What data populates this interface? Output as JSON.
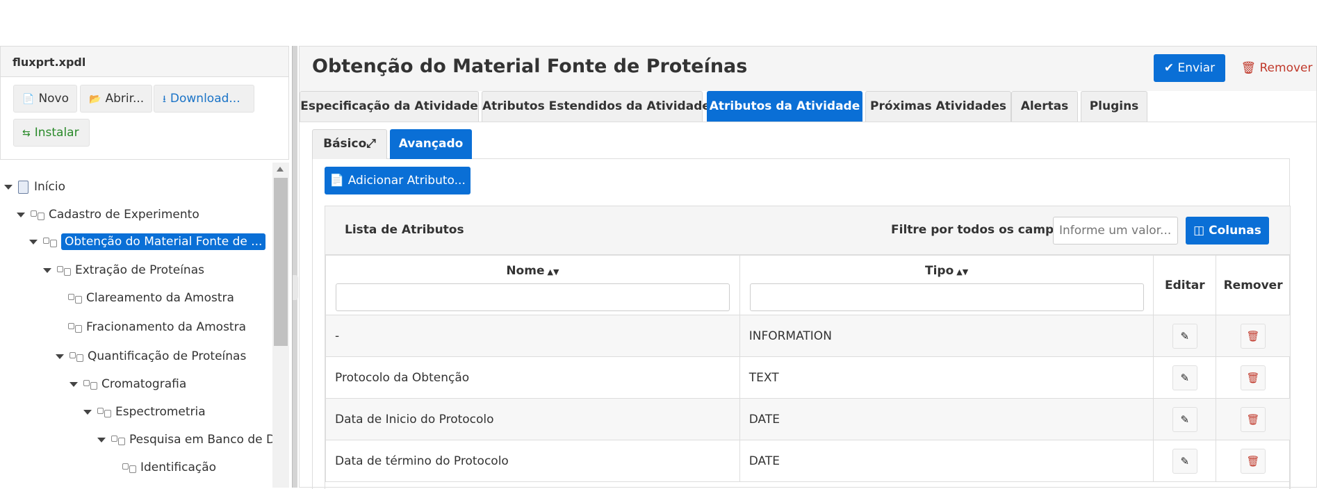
{
  "file": {
    "title": "fluxprt.xpdl",
    "buttons": {
      "novo": "Novo",
      "abrir": "Abrir...",
      "download": "Download...",
      "instalar": "Instalar"
    }
  },
  "tree": {
    "nodes": [
      {
        "label": "Início",
        "expanded": true
      },
      {
        "label": "Cadastro de Experimento",
        "expanded": true
      },
      {
        "label": "Obtenção do Material Fonte de ...",
        "expanded": true,
        "selected": true
      },
      {
        "label": "Extração de Proteínas",
        "expanded": true
      },
      {
        "label": "Clareamento da Amostra"
      },
      {
        "label": "Fracionamento da Amostra"
      },
      {
        "label": "Quantificação de Proteínas",
        "expanded": true
      },
      {
        "label": "Cromatografia",
        "expanded": true
      },
      {
        "label": "Espectrometria",
        "expanded": true
      },
      {
        "label": "Pesquisa em Banco de Dad",
        "expanded": true
      },
      {
        "label": "Identificação"
      }
    ]
  },
  "main": {
    "title": "Obtenção do Material Fonte de Proteínas",
    "enviar": "Enviar",
    "remover": "Remover",
    "tabs": [
      "Especificação da Atividade",
      "Atributos Estendidos da Atividade",
      "Atributos da Atividade",
      "Próximas Atividades",
      "Alertas",
      "Plugins"
    ],
    "active_tab": "Atributos da Atividade",
    "subtabs": [
      "Básico",
      "Avançado"
    ],
    "active_subtab": "Avançado",
    "add_button": "Adicionar Atributo..."
  },
  "list": {
    "title": "Lista de Atributos",
    "filter_label": "Filtre por todos os campos:",
    "filter_placeholder": "Informe um valor...",
    "columns_button": "Colunas",
    "headers": {
      "nome": "Nome",
      "tipo": "Tipo",
      "editar": "Editar",
      "remover": "Remover"
    },
    "rows": [
      {
        "nome": "-",
        "tipo": "INFORMATION"
      },
      {
        "nome": "Protocolo da Obtenção",
        "tipo": "TEXT"
      },
      {
        "nome": "Data de Inicio do Protocolo",
        "tipo": "DATE"
      },
      {
        "nome": "Data de término do Protocolo",
        "tipo": "DATE"
      }
    ]
  },
  "colors": {
    "accent": "#0a6fd6",
    "danger": "#c0392b",
    "success": "#2a8a2a"
  },
  "icons": [
    "file-icon",
    "folder-open-icon",
    "download-icon",
    "exchange-icon",
    "document-icon",
    "activity-icon",
    "send-check-icon",
    "trash-icon",
    "expand-icon",
    "columns-icon",
    "sort-icon",
    "pencil-icon"
  ]
}
